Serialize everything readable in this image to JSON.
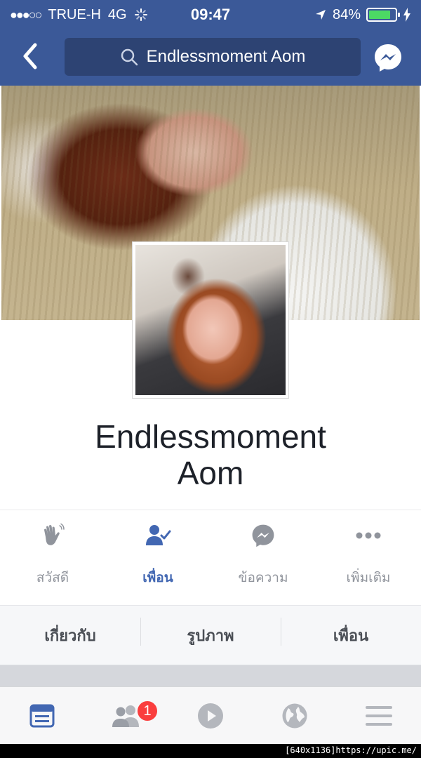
{
  "status_bar": {
    "signal": "●●●○○",
    "carrier": "TRUE-H",
    "network": "4G",
    "time": "09:47",
    "battery_percent": "84%",
    "battery_level": 0.84
  },
  "header": {
    "search_text": "Endlessmoment Aom",
    "icons": [
      "back-chevron-icon",
      "search-icon",
      "messenger-icon"
    ]
  },
  "profile": {
    "name_line1": "Endlessmoment",
    "name_line2": "Aom"
  },
  "actions": [
    {
      "label": "สวัสดี",
      "icon": "wave-hand-icon",
      "active": false
    },
    {
      "label": "เพื่อน",
      "icon": "friend-check-icon",
      "active": true
    },
    {
      "label": "ข้อความ",
      "icon": "messenger-icon",
      "active": false
    },
    {
      "label": "เพิ่มเติม",
      "icon": "more-dots-icon",
      "active": false
    }
  ],
  "tabs": [
    {
      "label": "เกี่ยวกับ"
    },
    {
      "label": "รูปภาพ"
    },
    {
      "label": "เพื่อน"
    }
  ],
  "bottom_nav": {
    "items": [
      "news-feed-icon",
      "friend-requests-icon",
      "video-icon",
      "globe-icon",
      "menu-icon"
    ],
    "friend_requests_badge": "1"
  },
  "footer_text": "[640x1136]https://upic.me/",
  "colors": {
    "brand": "#3b5998",
    "accent": "#4267b2",
    "badge": "#fa3e3e",
    "battery": "#4cd964"
  }
}
